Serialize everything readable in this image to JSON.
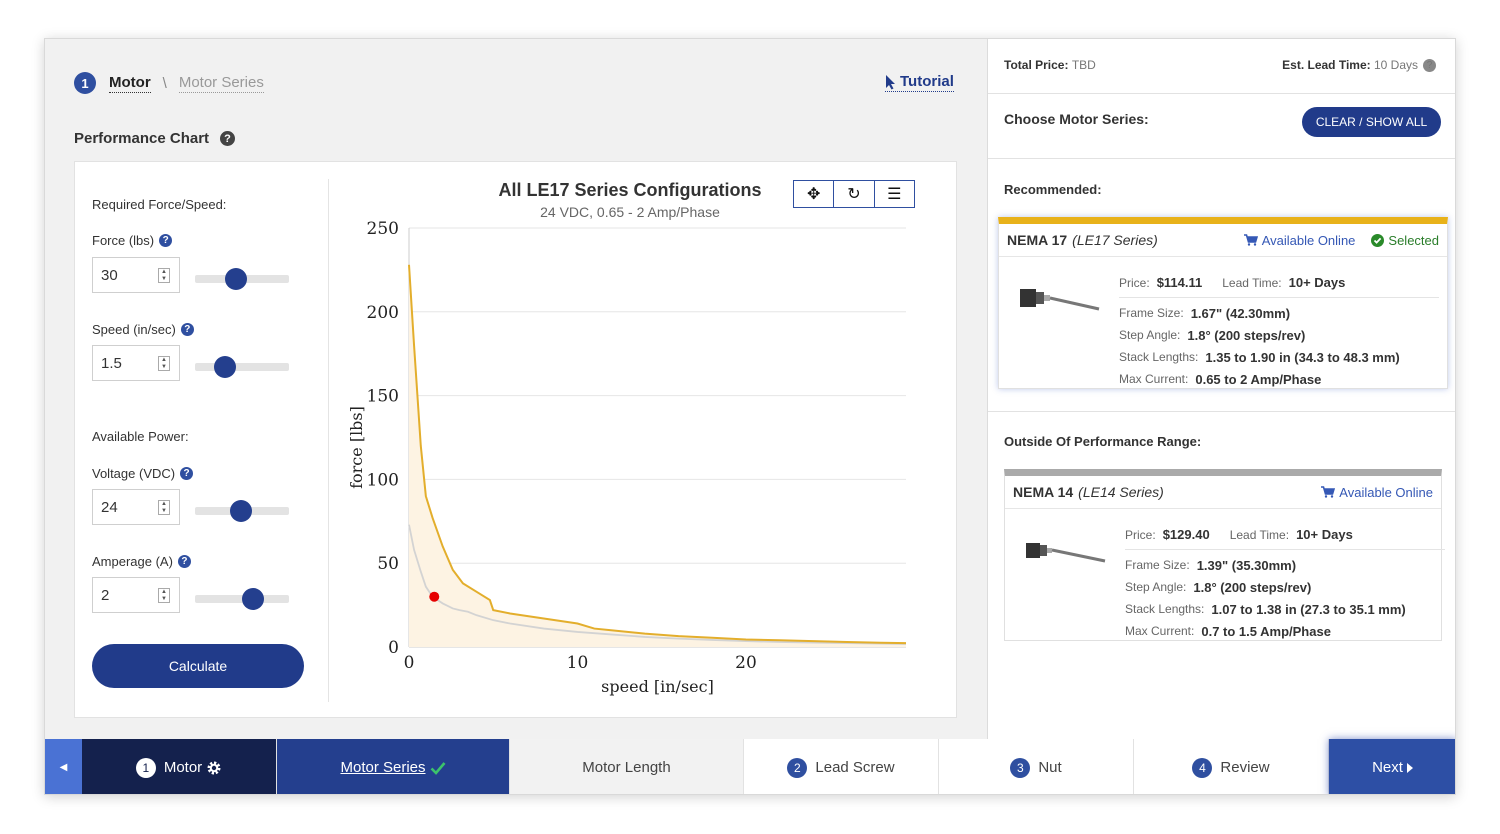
{
  "breadcrumb": {
    "step_number": "1",
    "current": "Motor",
    "separator": "\\",
    "next": "Motor Series"
  },
  "tutorial": {
    "label": "Tutorial"
  },
  "performance": {
    "title": "Performance Chart",
    "help": "?"
  },
  "form": {
    "required_heading": "Required Force/Speed:",
    "force": {
      "label": "Force (lbs)",
      "value": "30",
      "slider_level": 0.42
    },
    "speed": {
      "label": "Speed (in/sec)",
      "value": "1.5",
      "slider_level": 0.27
    },
    "power_heading": "Available Power:",
    "voltage": {
      "label": "Voltage (VDC)",
      "value": "24",
      "slider_level": 0.48
    },
    "amperage": {
      "label": "Amperage (A)",
      "value": "2",
      "slider_level": 0.65
    },
    "calculate_label": "Calculate"
  },
  "chart_toolbar": {
    "pan": "✥",
    "reset": "↻",
    "menu": "☰"
  },
  "chart_data": {
    "type": "area",
    "title": "All LE17 Series Configurations",
    "subtitle": "24 VDC, 0.65 - 2 Amp/Phase",
    "xlabel": "speed [in/sec]",
    "ylabel": "force [lbs]",
    "xlim": [
      0,
      29.5
    ],
    "ylim": [
      0,
      250
    ],
    "x_ticks": [
      "0",
      "10",
      "20"
    ],
    "y_ticks": [
      "0",
      "50",
      "100",
      "150",
      "200",
      "250"
    ],
    "series": [
      {
        "color": "#e3ae2c",
        "x": [
          0,
          0.3,
          0.7,
          1.0,
          1.4,
          2.0,
          2.6,
          3.2,
          4.0,
          4.8,
          5.0,
          6.0,
          8.0,
          10.0,
          11.0,
          12.0,
          14.0,
          16.0,
          18.0,
          20.0,
          22.0,
          24.0,
          26.0,
          28.0,
          29.5
        ],
        "y": [
          228,
          180,
          120,
          90,
          77,
          60,
          46,
          38,
          33,
          28,
          22,
          20,
          17,
          14,
          11,
          10,
          8,
          6.5,
          5.5,
          4.5,
          4,
          3.5,
          3,
          2.5,
          2.3
        ]
      },
      {
        "color": "#d3d3d3",
        "x": [
          0,
          0.3,
          0.7,
          1.0,
          1.4,
          2.0,
          2.6,
          3.0,
          3.5,
          4.0,
          5.0,
          6.0,
          8.0,
          10.0,
          12.0,
          14.0,
          16.0,
          18.0,
          20.0,
          22.0,
          24.0,
          26.0,
          28.0,
          29.5
        ],
        "y": [
          73,
          58,
          45,
          36,
          30,
          26,
          23,
          22,
          21,
          19,
          16,
          14,
          11,
          9,
          7.5,
          6,
          5,
          4.2,
          3.5,
          3,
          2.6,
          2.3,
          2,
          1.8
        ]
      }
    ],
    "point": {
      "x": 1.5,
      "y": 30,
      "color": "#e60000"
    },
    "grid": true
  },
  "summary": {
    "total_price_label": "Total Price:",
    "total_price_value": "TBD",
    "lead_time_label": "Est. Lead Time:",
    "lead_time_value": "10 Days"
  },
  "series_panel": {
    "choose_label": "Choose Motor Series:",
    "clear_button": "CLEAR / SHOW ALL",
    "recommended_heading": "Recommended:",
    "outside_heading": "Outside Of Performance Range:"
  },
  "cards": [
    {
      "name": "NEMA 17",
      "series": "(LE17 Series)",
      "available": "Available Online",
      "selected": "Selected",
      "price_label": "Price:",
      "price": "$114.11",
      "lead_label": "Lead Time:",
      "lead": "10+ Days",
      "frame_label": "Frame Size:",
      "frame": "1.67\" (42.30mm)",
      "step_label": "Step Angle:",
      "step": "1.8° (200 steps/rev)",
      "stack_label": "Stack Lengths:",
      "stack": "1.35 to 1.90 in (34.3 to 48.3 mm)",
      "current_label": "Max Current:",
      "current": "0.65 to 2 Amp/Phase"
    },
    {
      "name": "NEMA 14",
      "series": "(LE14 Series)",
      "available": "Available Online",
      "price_label": "Price:",
      "price": "$129.40",
      "lead_label": "Lead Time:",
      "lead": "10+ Days",
      "frame_label": "Frame Size:",
      "frame": "1.39\" (35.30mm)",
      "step_label": "Step Angle:",
      "step": "1.8° (200 steps/rev)",
      "stack_label": "Stack Lengths:",
      "stack": "1.07 to 1.38 in (27.3 to 35.1 mm)",
      "current_label": "Max Current:",
      "current": "0.7 to 1.5 Amp/Phase"
    }
  ],
  "bottom_nav": {
    "prev": "◀",
    "motor_num": "1",
    "motor": "Motor",
    "motor_series": "Motor Series",
    "motor_length": "Motor Length",
    "lead_num": "2",
    "lead_screw": "Lead Screw",
    "nut_num": "3",
    "nut": "Nut",
    "review_num": "4",
    "review": "Review",
    "next": "Next"
  }
}
